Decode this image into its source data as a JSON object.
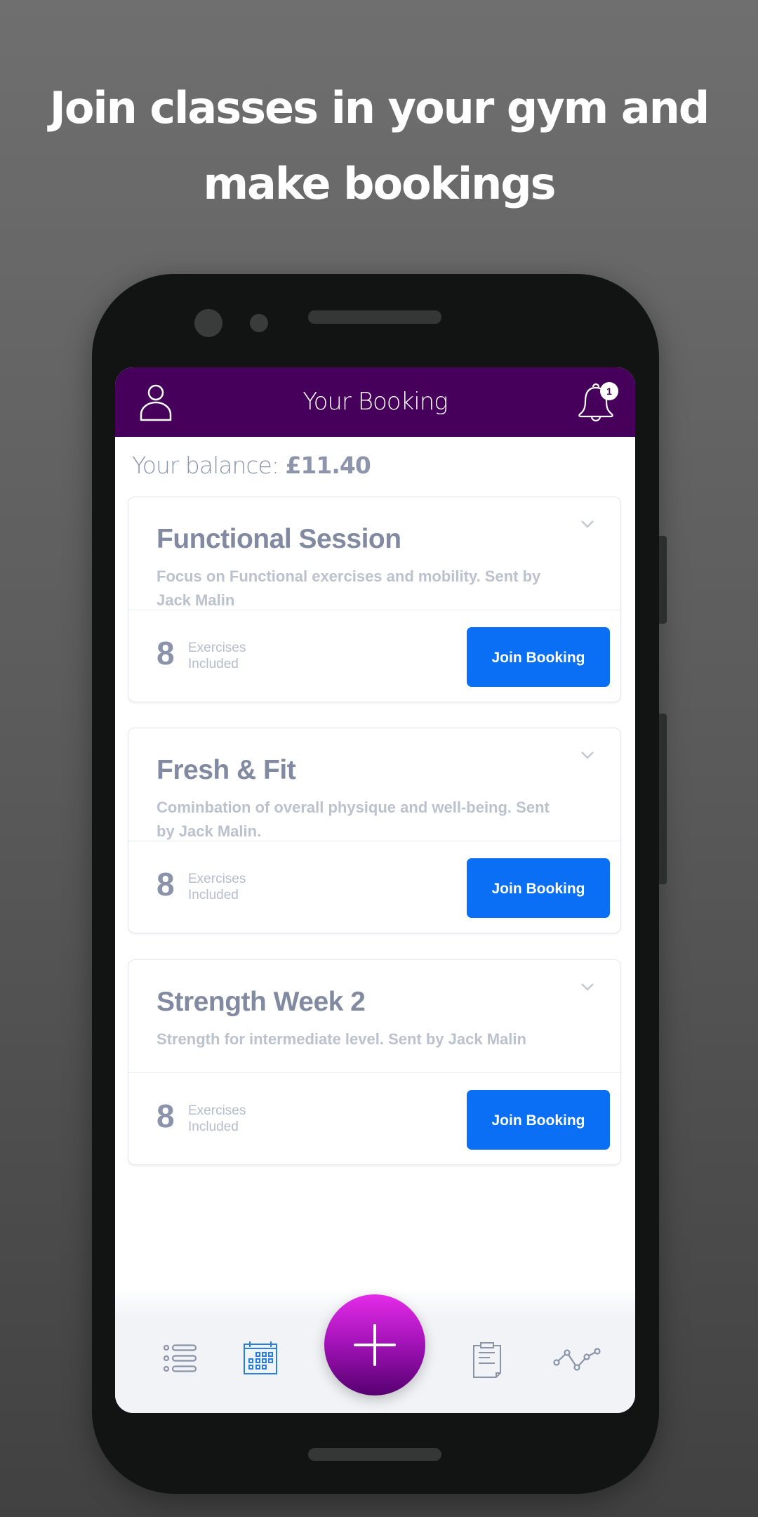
{
  "headline": {
    "line1": "Join classes in your gym and",
    "line2": "make bookings"
  },
  "appbar": {
    "title": "Your Booking",
    "left_icon": "user-icon",
    "right_icon": "bell-icon",
    "notification_count": "1"
  },
  "balance": {
    "label": "Your balance:",
    "amount": "£11.40"
  },
  "bookings": [
    {
      "title": "Functional Session",
      "description": "Focus on Functional exercises and mobility. Sent by Jack Malin",
      "count": "8",
      "count_label_1": "Exercises",
      "count_label_2": "Included",
      "button": "Join Booking"
    },
    {
      "title": "Fresh & Fit",
      "description": "Cominbation of overall physique and well-being. Sent by Jack Malin.",
      "count": "8",
      "count_label_1": "Exercises",
      "count_label_2": "Included",
      "button": "Join Booking"
    },
    {
      "title": "Strength Week 2",
      "description": "Strength for intermediate level. Sent by Jack Malin",
      "count": "8",
      "count_label_1": "Exercises",
      "count_label_2": "Included",
      "button": "Join Booking"
    }
  ],
  "navbar": {
    "items": [
      {
        "icon": "list-icon",
        "active": false
      },
      {
        "icon": "calendar-icon",
        "active": true
      },
      {
        "icon": "plus-icon",
        "role": "fab"
      },
      {
        "icon": "clipboard-icon",
        "active": false
      },
      {
        "icon": "chart-line-icon",
        "active": false
      }
    ]
  },
  "colors": {
    "appbar": "#46005c",
    "primary_button": "#0a6ff5",
    "active_nav": "#2a7de1",
    "inactive_nav": "#8a93a7",
    "fab_top": "#e42be9",
    "fab_bottom": "#560070",
    "text_title": "#818aa1",
    "text_muted": "#bcc1ce"
  }
}
